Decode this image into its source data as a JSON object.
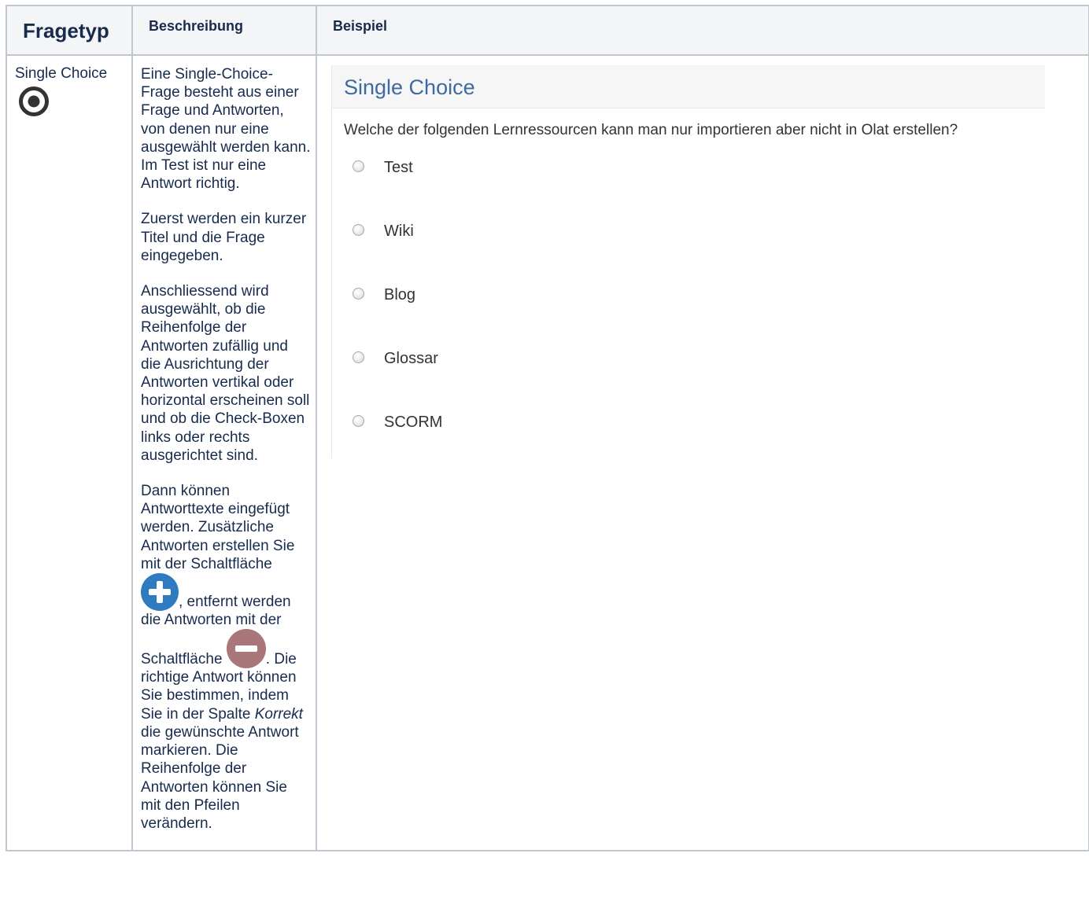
{
  "table": {
    "headers": {
      "type": "Fragetyp",
      "description": "Beschreibung",
      "example": "Beispiel"
    },
    "row": {
      "type_label": "Single Choice",
      "type_icon": "radio-target-icon",
      "description": {
        "p1": "Eine Single-Choice-Frage besteht aus einer Frage und Antworten, von denen nur eine ausgewählt werden kann. Im Test ist nur eine Antwort richtig.",
        "p2": "Zuerst werden ein kurzer Titel und die Frage eingegeben.",
        "p3": "Anschliessend wird ausgewählt, ob die Reihenfolge der Antworten zufällig und die Ausrichtung der Antworten vertikal oder horizontal erscheinen soll und ob die Check-Boxen links oder rechts ausgerichtet sind.",
        "p4_part1": "Dann können Antworttexte eingefügt werden. Zusätzliche Antworten erstellen Sie mit der Schaltfläche ",
        "p4_part2": ", entfernt werden die Antworten mit der Schaltfläche ",
        "p4_part3": ". Die richtige Antwort können Sie bestimmen, indem Sie in der Spalte ",
        "p4_italic": "Korrekt",
        "p4_part4": " die gewünschte Antwort markieren. Die Reihenfolge der Antworten können Sie mit den Pfeilen verändern.",
        "add_icon": "plus-circle-icon",
        "remove_icon": "minus-circle-icon",
        "add_icon_color": "#2f7bbf",
        "remove_icon_color": "#a9777a"
      },
      "example": {
        "title": "Single Choice",
        "question": "Welche der folgenden Lernressourcen kann man nur importieren aber nicht in Olat erstellen?",
        "options": [
          "Test",
          "Wiki",
          "Blog",
          "Glossar",
          "SCORM"
        ]
      }
    }
  },
  "colors": {
    "border": "#c1c7d0",
    "header_bg": "#f4f5f7",
    "panel_title": "#3c6aa1",
    "text": "#172b4d"
  }
}
